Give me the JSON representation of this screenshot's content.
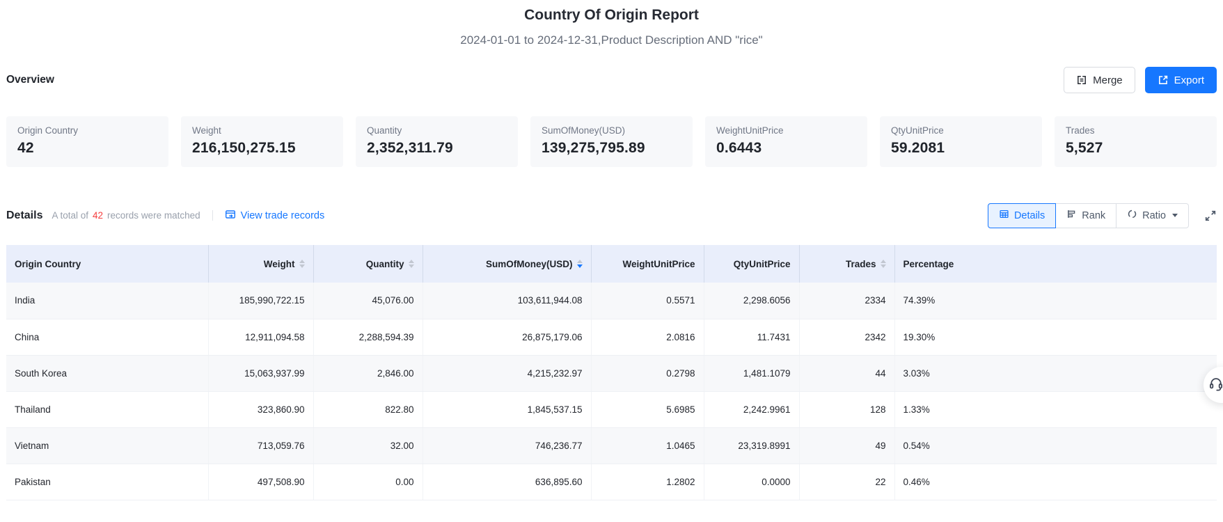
{
  "page": {
    "title": "Country Of Origin Report",
    "subtitle": "2024-01-01 to 2024-12-31,Product Description AND \"rice\""
  },
  "colors": {
    "primary": "#1677ff",
    "count_red": "#f53f3f",
    "table_header_bg": "#e9eefb"
  },
  "overview": {
    "heading": "Overview",
    "merge_label": "Merge",
    "export_label": "Export",
    "cards": [
      {
        "label": "Origin Country",
        "value": "42"
      },
      {
        "label": "Weight",
        "value": "216,150,275.15"
      },
      {
        "label": "Quantity",
        "value": "2,352,311.79"
      },
      {
        "label": "SumOfMoney(USD)",
        "value": "139,275,795.89"
      },
      {
        "label": "WeightUnitPrice",
        "value": "0.6443"
      },
      {
        "label": "QtyUnitPrice",
        "value": "59.2081"
      },
      {
        "label": "Trades",
        "value": "5,527"
      }
    ]
  },
  "details": {
    "heading": "Details",
    "summary_prefix": "A total of",
    "summary_count": "42",
    "summary_suffix": "records were matched",
    "link_label": "View trade records",
    "view_toggle": [
      {
        "label": "Details",
        "active": true
      },
      {
        "label": "Rank",
        "active": false
      },
      {
        "label": "Ratio",
        "active": false,
        "dropdown": true
      }
    ]
  },
  "table": {
    "columns": [
      {
        "label": "Origin Country",
        "sortable": false
      },
      {
        "label": "Weight",
        "sortable": true
      },
      {
        "label": "Quantity",
        "sortable": true
      },
      {
        "label": "SumOfMoney(USD)",
        "sortable": true,
        "sort": "desc"
      },
      {
        "label": "WeightUnitPrice",
        "sortable": false
      },
      {
        "label": "QtyUnitPrice",
        "sortable": false
      },
      {
        "label": "Trades",
        "sortable": true
      },
      {
        "label": "Percentage",
        "sortable": false
      }
    ],
    "rows": [
      {
        "country": "India",
        "weight": "185,990,722.15",
        "quantity": "45,076.00",
        "sum": "103,611,944.08",
        "weight_unit_price": "0.5571",
        "qty_unit_price": "2,298.6056",
        "trades": "2334",
        "percentage": "74.39%"
      },
      {
        "country": "China",
        "weight": "12,911,094.58",
        "quantity": "2,288,594.39",
        "sum": "26,875,179.06",
        "weight_unit_price": "2.0816",
        "qty_unit_price": "11.7431",
        "trades": "2342",
        "percentage": "19.30%"
      },
      {
        "country": "South Korea",
        "weight": "15,063,937.99",
        "quantity": "2,846.00",
        "sum": "4,215,232.97",
        "weight_unit_price": "0.2798",
        "qty_unit_price": "1,481.1079",
        "trades": "44",
        "percentage": "3.03%"
      },
      {
        "country": "Thailand",
        "weight": "323,860.90",
        "quantity": "822.80",
        "sum": "1,845,537.15",
        "weight_unit_price": "5.6985",
        "qty_unit_price": "2,242.9961",
        "trades": "128",
        "percentage": "1.33%"
      },
      {
        "country": "Vietnam",
        "weight": "713,059.76",
        "quantity": "32.00",
        "sum": "746,236.77",
        "weight_unit_price": "1.0465",
        "qty_unit_price": "23,319.8991",
        "trades": "49",
        "percentage": "0.54%"
      },
      {
        "country": "Pakistan",
        "weight": "497,508.90",
        "quantity": "0.00",
        "sum": "636,895.60",
        "weight_unit_price": "1.2802",
        "qty_unit_price": "0.0000",
        "trades": "22",
        "percentage": "0.46%"
      }
    ]
  }
}
